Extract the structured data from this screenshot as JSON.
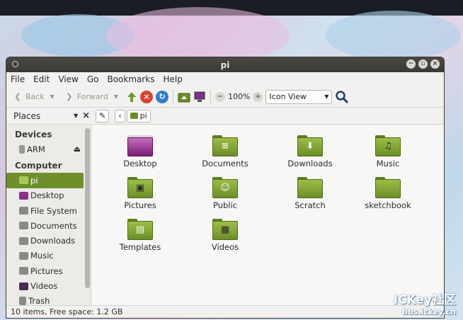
{
  "window": {
    "title": "pi",
    "controls": [
      "minimize",
      "maximize",
      "close"
    ]
  },
  "menubar": [
    "File",
    "Edit",
    "View",
    "Go",
    "Bookmarks",
    "Help"
  ],
  "toolbar": {
    "back_label": "Back",
    "forward_label": "Forward",
    "zoom": "100%",
    "view_mode": "Icon View"
  },
  "locationbar": {
    "places_label": "Places",
    "path_current": "pi"
  },
  "sidebar": {
    "devices_header": "Devices",
    "devices": [
      {
        "label": "ARM",
        "icon": "drive-icon"
      }
    ],
    "computer_header": "Computer",
    "items": [
      {
        "label": "pi",
        "icon": "home-folder-icon",
        "active": true
      },
      {
        "label": "Desktop",
        "icon": "desktop-icon"
      },
      {
        "label": "File System",
        "icon": "filesystem-icon"
      },
      {
        "label": "Documents",
        "icon": "folder-icon"
      },
      {
        "label": "Downloads",
        "icon": "folder-icon"
      },
      {
        "label": "Music",
        "icon": "music-icon"
      },
      {
        "label": "Pictures",
        "icon": "pictures-icon"
      },
      {
        "label": "Videos",
        "icon": "videos-icon"
      },
      {
        "label": "Trash",
        "icon": "trash-icon"
      }
    ]
  },
  "files": [
    {
      "label": "Desktop",
      "icon": "desktop-folder-icon"
    },
    {
      "label": "Documents",
      "icon": "documents-folder-icon"
    },
    {
      "label": "Downloads",
      "icon": "downloads-folder-icon"
    },
    {
      "label": "Music",
      "icon": "music-folder-icon"
    },
    {
      "label": "Pictures",
      "icon": "pictures-folder-icon"
    },
    {
      "label": "Public",
      "icon": "public-folder-icon"
    },
    {
      "label": "Scratch",
      "icon": "folder-icon"
    },
    {
      "label": "sketchbook",
      "icon": "folder-icon"
    },
    {
      "label": "Templates",
      "icon": "templates-folder-icon"
    },
    {
      "label": "Videos",
      "icon": "videos-folder-icon"
    }
  ],
  "status": "10 items, Free space: 1.2 GB",
  "watermark": {
    "line1": "ICKey社区",
    "line2": "bbs.ickey.cn"
  },
  "colors": {
    "accent": "#6f8f2d",
    "titlebar": "#3c3b37",
    "folder": "#8fb13d"
  }
}
